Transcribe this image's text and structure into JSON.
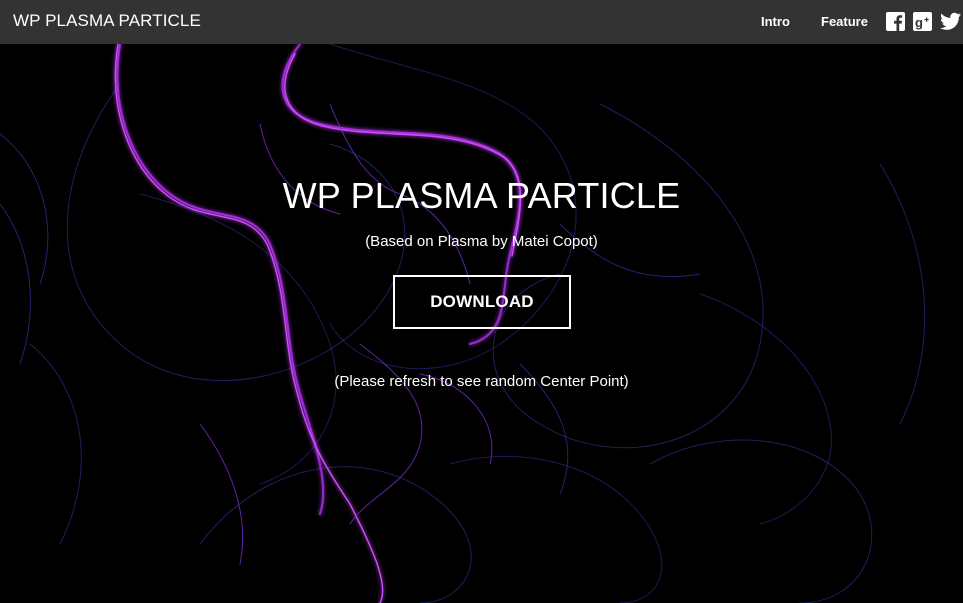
{
  "navbar": {
    "brand": "WP PLASMA PARTICLE",
    "links": [
      {
        "label": "Intro"
      },
      {
        "label": "Feature"
      }
    ],
    "social": [
      {
        "icon": "facebook-icon"
      },
      {
        "icon": "google-plus-icon"
      },
      {
        "icon": "twitter-icon"
      }
    ],
    "background_color": "#333333"
  },
  "hero": {
    "title": "WP PLASMA PARTICLE",
    "subtitle": "(Based on Plasma by Matei Copot)",
    "download_label": "DOWNLOAD",
    "note": "(Please refresh to see random Center Point)",
    "background_color": "#000000",
    "plasma_colors": [
      "#c23cf0",
      "#7a2cc9",
      "#3b2f9c",
      "#2a2f7a"
    ]
  }
}
